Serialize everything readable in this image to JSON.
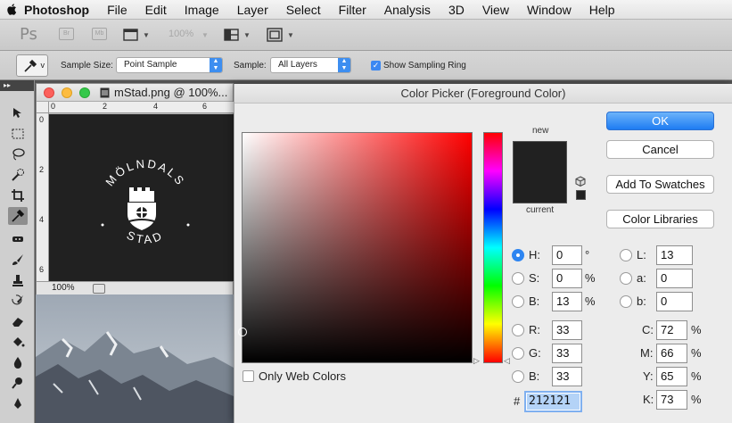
{
  "menubar": {
    "app": "Photoshop",
    "items": [
      "File",
      "Edit",
      "Image",
      "Layer",
      "Select",
      "Filter",
      "Analysis",
      "3D",
      "View",
      "Window",
      "Help"
    ]
  },
  "appbar": {
    "logo": "Ps",
    "bridge": "Br",
    "minibridge": "Mb",
    "zoom": "100%"
  },
  "options": {
    "tool_variant": "v",
    "sample_size_label": "Sample Size:",
    "sample_size_value": "Point Sample",
    "sample_label": "Sample:",
    "sample_value": "All Layers",
    "sampling_ring_label": "Show Sampling Ring",
    "sampling_ring_checked": true
  },
  "tools_grip": "▸▸",
  "document": {
    "title": "mStad.png @ 100%...",
    "zoom": "100%",
    "ruler_h": [
      "0",
      "2",
      "4",
      "6"
    ],
    "ruler_v": [
      "0",
      "2",
      "4",
      "6"
    ],
    "logo_text_top": "MÖLNDALS",
    "logo_text_bottom": "STAD"
  },
  "picker": {
    "title": "Color Picker (Foreground Color)",
    "new_label": "new",
    "current_label": "current",
    "swatch_color": "#212121",
    "buttons": {
      "ok": "OK",
      "cancel": "Cancel",
      "add_to_swatches": "Add To Swatches",
      "color_libraries": "Color Libraries"
    },
    "hsb": {
      "h_label": "H:",
      "h": "0",
      "h_unit": "°",
      "s_label": "S:",
      "s": "0",
      "s_unit": "%",
      "b_label": "B:",
      "b": "13",
      "b_unit": "%"
    },
    "rgb": {
      "r_label": "R:",
      "r": "33",
      "g_label": "G:",
      "g": "33",
      "b_label": "B:",
      "b": "33"
    },
    "lab": {
      "l_label": "L:",
      "l": "13",
      "a_label": "a:",
      "a": "0",
      "b_label": "b:",
      "b": "0"
    },
    "cmyk": {
      "c_label": "C:",
      "c": "72",
      "m_label": "M:",
      "m": "66",
      "y_label": "Y:",
      "y": "65",
      "k_label": "K:",
      "k": "73",
      "unit": "%"
    },
    "hex_label": "#",
    "hex": "212121",
    "only_web_colors": "Only Web Colors",
    "selected_mode": "H"
  }
}
